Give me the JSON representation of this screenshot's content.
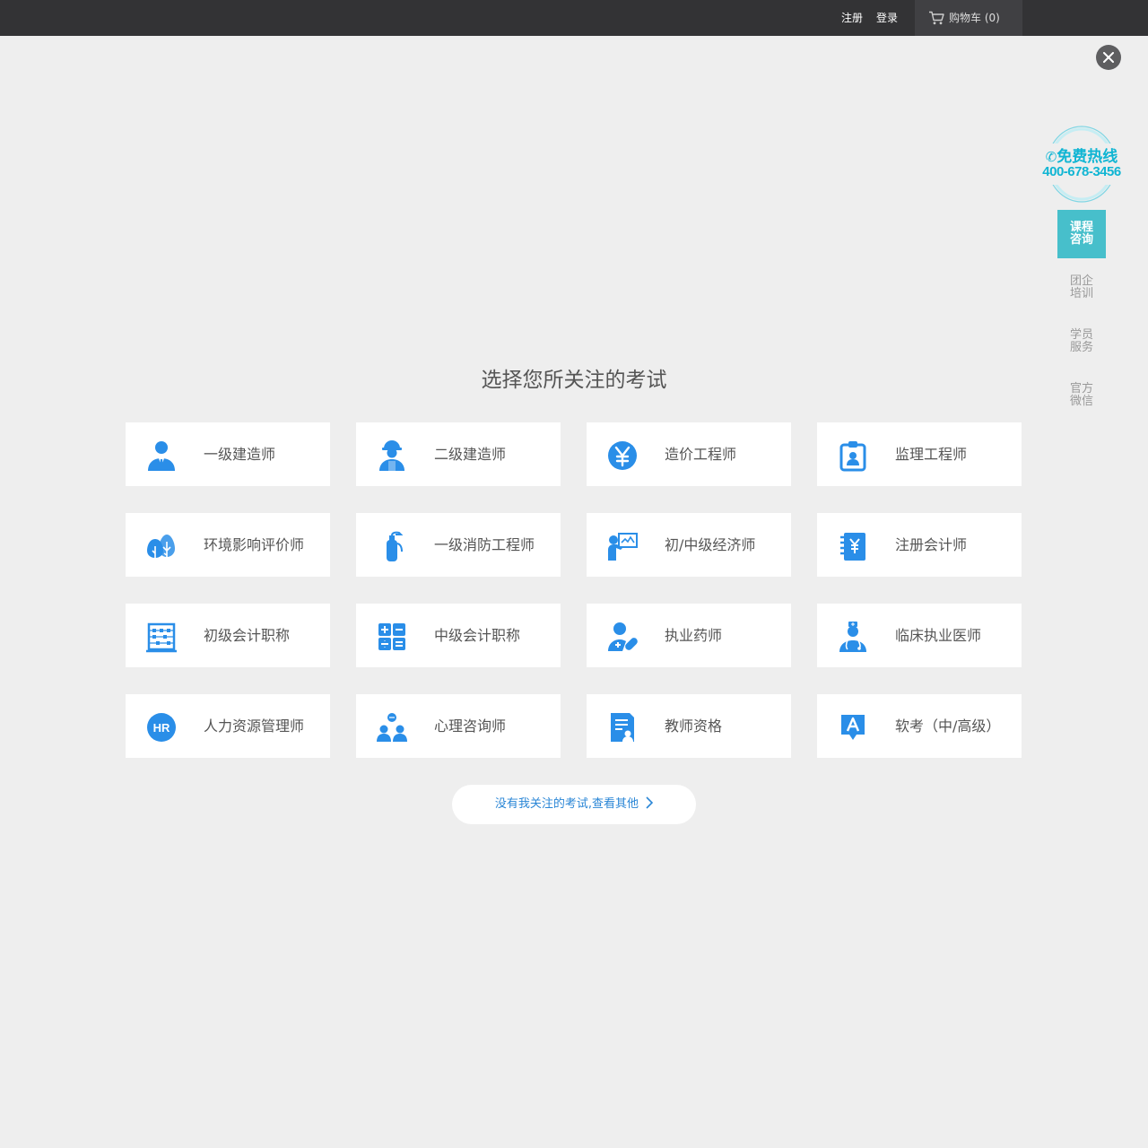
{
  "topbar": {
    "register_label": "注册",
    "login_label": "登录",
    "cart_label": "购物车",
    "cart_count": "(0)"
  },
  "sidebar": {
    "hotline_title": "免费热线",
    "hotline_number": "400-678-3456",
    "items": [
      {
        "line1": "课程",
        "line2": "咨询",
        "active": true
      },
      {
        "line1": "团企",
        "line2": "培训",
        "active": false
      },
      {
        "line1": "学员",
        "line2": "服务",
        "active": false
      },
      {
        "line1": "官方",
        "line2": "微信",
        "active": false
      }
    ]
  },
  "main": {
    "title": "选择您所关注的考试",
    "more_label": "没有我关注的考试,查看其他",
    "exams": [
      {
        "label": "一级建造师",
        "icon": "engineer-person-icon"
      },
      {
        "label": "二级建造师",
        "icon": "hardhat-worker-icon"
      },
      {
        "label": "造价工程师",
        "icon": "yen-coin-icon"
      },
      {
        "label": "监理工程师",
        "icon": "id-badge-icon"
      },
      {
        "label": "环境影响评价师",
        "icon": "trees-icon"
      },
      {
        "label": "一级消防工程师",
        "icon": "fire-extinguisher-icon"
      },
      {
        "label": "初/中级经济师",
        "icon": "presenter-chart-icon"
      },
      {
        "label": "注册会计师",
        "icon": "yen-ledger-icon"
      },
      {
        "label": "初级会计职称",
        "icon": "abacus-icon"
      },
      {
        "label": "中级会计职称",
        "icon": "calculator-icon"
      },
      {
        "label": "执业药师",
        "icon": "pharmacist-pill-icon"
      },
      {
        "label": "临床执业医师",
        "icon": "doctor-icon"
      },
      {
        "label": "人力资源管理师",
        "icon": "hr-badge-icon"
      },
      {
        "label": "心理咨询师",
        "icon": "counseling-people-icon"
      },
      {
        "label": "教师资格",
        "icon": "teacher-certificate-icon"
      },
      {
        "label": "软考（中/高级）",
        "icon": "letter-a-chat-icon"
      }
    ]
  },
  "colors": {
    "topbar_bg": "#333335",
    "accent_blue": "#2a8ee8",
    "hotline_teal": "#10b5d3",
    "side_active": "#47bfcb",
    "page_bg": "#eeeeee"
  }
}
